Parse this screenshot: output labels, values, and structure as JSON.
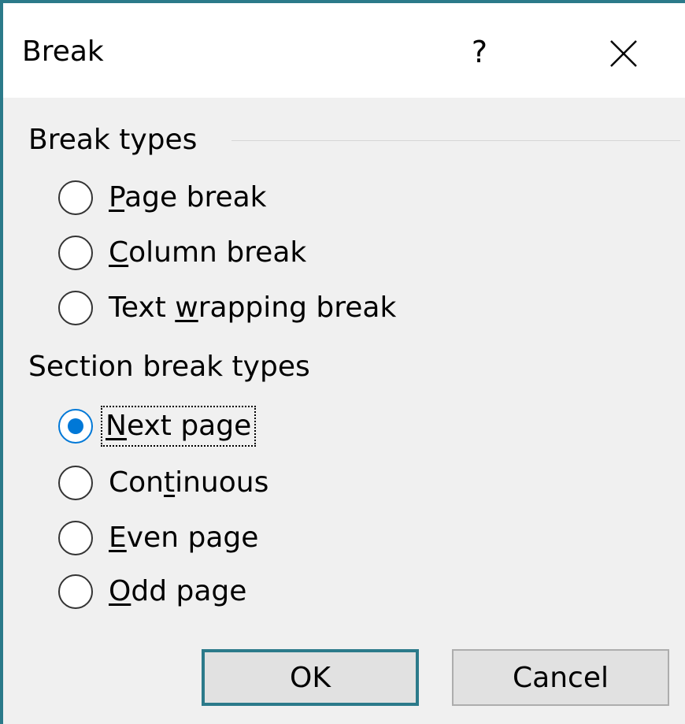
{
  "window": {
    "title": "Break",
    "help_label": "?"
  },
  "break_types": {
    "label": "Break types",
    "options": [
      {
        "pre": "",
        "u": "P",
        "post": "age break",
        "checked": false
      },
      {
        "pre": "",
        "u": "C",
        "post": "olumn break",
        "checked": false
      },
      {
        "pre": "Text ",
        "u": "w",
        "post": "rapping break",
        "checked": false
      }
    ]
  },
  "section_break_types": {
    "label": "Section break types",
    "options": [
      {
        "pre": "",
        "u": "N",
        "post": "ext page",
        "checked": true
      },
      {
        "pre": "Con",
        "u": "t",
        "post": "inuous",
        "checked": false
      },
      {
        "pre": "",
        "u": "E",
        "post": "ven page",
        "checked": false
      },
      {
        "pre": "",
        "u": "O",
        "post": "dd page",
        "checked": false
      }
    ]
  },
  "buttons": {
    "ok_label": "OK",
    "cancel_label": "Cancel"
  },
  "colors": {
    "accent": "#0078d7",
    "focus_border": "#2b7a8a"
  }
}
